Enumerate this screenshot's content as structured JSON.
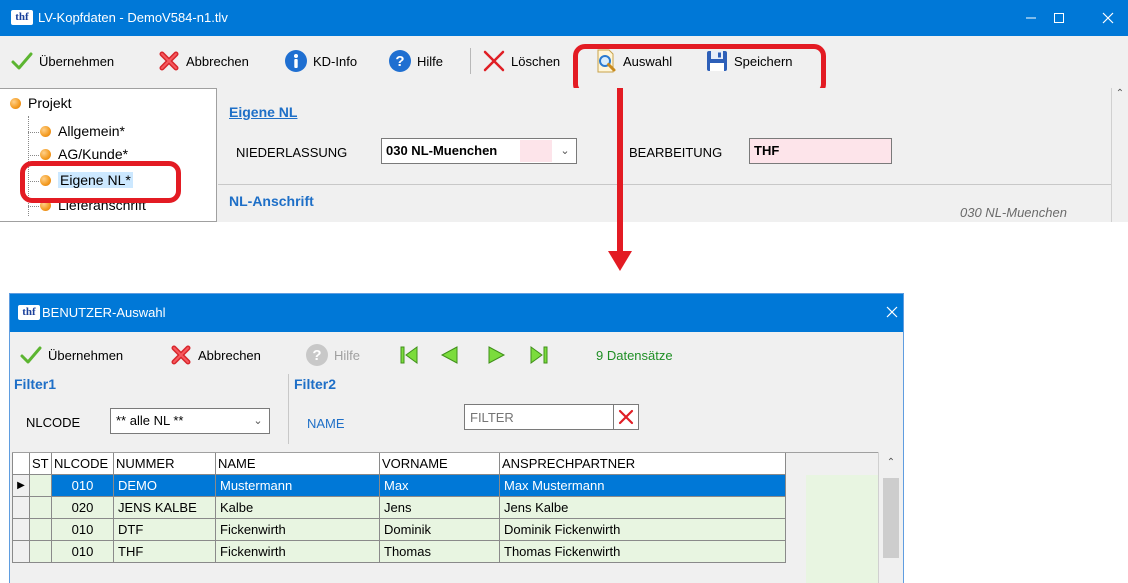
{
  "main_window": {
    "app_logo": "thf",
    "title": "LV-Kopfdaten - DemoV584-n1.tlv",
    "toolbar": {
      "uebernehmen": "Übernehmen",
      "abbrechen": "Abbrechen",
      "kd_info": "KD-Info",
      "hilfe": "Hilfe",
      "loeschen": "Löschen",
      "auswahl": "Auswahl",
      "speichern": "Speichern"
    },
    "tree": {
      "root": "Projekt",
      "items": [
        "Allgemein*",
        "AG/Kunde*",
        "Eigene NL*",
        "Lieferanschrift"
      ],
      "selected_index": 2
    },
    "section_eigene_nl": {
      "title": "Eigene NL",
      "niederlassung_label": "NIEDERLASSUNG",
      "niederlassung_value": "030 NL-Muenchen",
      "bearbeitung_label": "BEARBEITUNG",
      "bearbeitung_value": "THF"
    },
    "section_anschrift": {
      "title": "NL-Anschrift",
      "info": "030 NL-Muenchen"
    }
  },
  "dialog": {
    "app_logo": "thf",
    "title": "BENUTZER-Auswahl",
    "toolbar": {
      "uebernehmen": "Übernehmen",
      "abbrechen": "Abbrechen",
      "hilfe": "Hilfe",
      "record_count": "9 Datensätze"
    },
    "filter1": {
      "title": "Filter1",
      "label": "NLCODE",
      "value": "** alle NL **"
    },
    "filter2": {
      "title": "Filter2",
      "label": "NAME",
      "placeholder": "FILTER"
    },
    "grid": {
      "columns": [
        "ST",
        "NLCODE",
        "NUMMER",
        "NAME",
        "VORNAME",
        "ANSPRECHPARTNER"
      ],
      "rows": [
        [
          "",
          "010",
          "DEMO",
          "Mustermann",
          "Max",
          "Max Mustermann"
        ],
        [
          "",
          "020",
          "JENS KALBE",
          "Kalbe",
          "Jens",
          "Jens Kalbe"
        ],
        [
          "",
          "010",
          "DTF",
          "Fickenwirth",
          "Dominik",
          "Dominik Fickenwirth"
        ],
        [
          "",
          "010",
          "THF",
          "Fickenwirth",
          "Thomas",
          "Thomas Fickenwirth"
        ]
      ],
      "selected_row": 0
    }
  },
  "colors": {
    "titlebar": "#0078d7",
    "highlight": "#e31b23",
    "section_title": "#1e6fc7",
    "grid_row_bg": "#e8f5e1",
    "record_count": "#1f8f25"
  }
}
